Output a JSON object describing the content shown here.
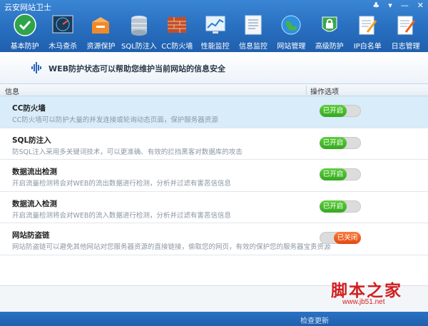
{
  "app": {
    "title": "云安网站卫士",
    "window_buttons": [
      "♣",
      "▾",
      "—",
      "✕"
    ]
  },
  "toolbar": [
    {
      "label": "基本防护",
      "icon": "shield-check-icon"
    },
    {
      "label": "木马查杀",
      "icon": "radar-icon"
    },
    {
      "label": "资源保护",
      "icon": "box-icon"
    },
    {
      "label": "SQL防注入",
      "icon": "database-icon"
    },
    {
      "label": "CC防火墙",
      "icon": "firewall-icon"
    },
    {
      "label": "性能监控",
      "icon": "monitor-chart-icon"
    },
    {
      "label": "信息监控",
      "icon": "document-icon"
    },
    {
      "label": "网站管理",
      "icon": "globe-icon"
    },
    {
      "label": "高级防护",
      "icon": "lock-icon"
    },
    {
      "label": "IP白名单",
      "icon": "note-pen-icon"
    },
    {
      "label": "日志管理",
      "icon": "log-pen-icon"
    }
  ],
  "subheader": {
    "text": "WEB防护状态可以帮助您维护当前网站的信息安全"
  },
  "table": {
    "columns": [
      "信息",
      "操作选项"
    ],
    "rows": [
      {
        "name": "CC防火墙",
        "desc": "CC防火墙可以防护大量的并发连接或轮询动态页面，保护服务器资源",
        "status": "已开启",
        "on": true
      },
      {
        "name": "SQL防注入",
        "desc": "防SQL注入采用多关键词技术，可以更准确、有效的拦挡黑客对数据库的攻击",
        "status": "已开启",
        "on": true
      },
      {
        "name": "数据流出检测",
        "desc": "开启流量检测将会对WEB的流出数据进行检测，分析并过滤有害恶信信息",
        "status": "已开启",
        "on": true
      },
      {
        "name": "数据流入检测",
        "desc": "开启流量检测将会对WEB的流入数据进行检测，分析并过滤有害恶信信息",
        "status": "已开启",
        "on": true
      },
      {
        "name": "网站防盗链",
        "desc": "网站防盗链可以避免其他网站对您服务器资源的直接链接，偷取您的网页，有效的保护您的服务器宝贵资源",
        "status": "已关闭",
        "on": false
      }
    ]
  },
  "status": {
    "version": "检查更新"
  },
  "watermark": {
    "text": "脚本之家",
    "url": "www.jb51.net"
  },
  "colors": {
    "toolbar_blue": "#2b72c3",
    "on_green": "#34a81f",
    "off_orange": "#e14a10",
    "selected_row": "#d8ecfa"
  }
}
